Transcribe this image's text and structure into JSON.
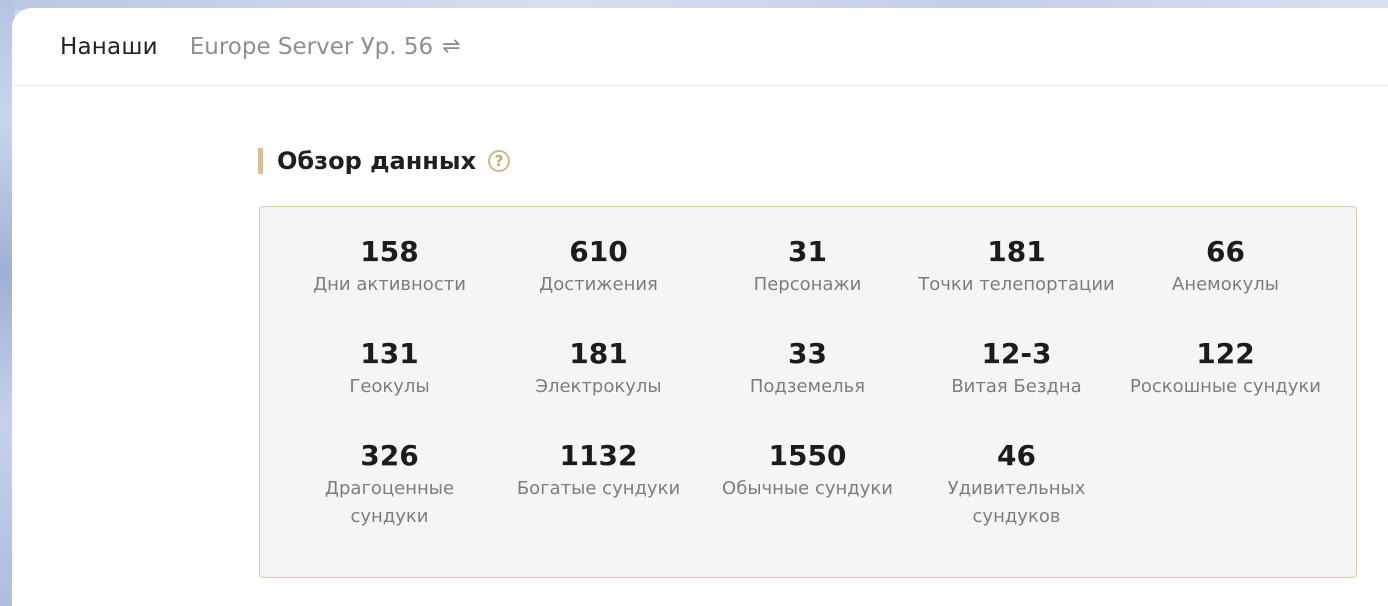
{
  "header": {
    "player_name": "Нанаши",
    "server_label": "Europe Server Ур. 56",
    "swap_icon": "⇌"
  },
  "section": {
    "title": "Обзор данных",
    "help_icon": "?"
  },
  "stats": [
    {
      "value": "158",
      "label": "Дни активности"
    },
    {
      "value": "610",
      "label": "Достижения"
    },
    {
      "value": "31",
      "label": "Персонажи"
    },
    {
      "value": "181",
      "label": "Точки телепортации"
    },
    {
      "value": "66",
      "label": "Анемокулы"
    },
    {
      "value": "131",
      "label": "Геокулы"
    },
    {
      "value": "181",
      "label": "Электрокулы"
    },
    {
      "value": "33",
      "label": "Подземелья"
    },
    {
      "value": "12-3",
      "label": "Витая Бездна"
    },
    {
      "value": "122",
      "label": "Роскошные сундуки"
    },
    {
      "value": "326",
      "label": "Драгоценные сундуки"
    },
    {
      "value": "1132",
      "label": "Богатые сундуки"
    },
    {
      "value": "1550",
      "label": "Обычные сундуки"
    },
    {
      "value": "46",
      "label": "Удивительных сундуков"
    }
  ],
  "colors": {
    "accent": "#d9c092",
    "box_border": "#dcc9a2",
    "box_background": "#f5f5f5"
  }
}
